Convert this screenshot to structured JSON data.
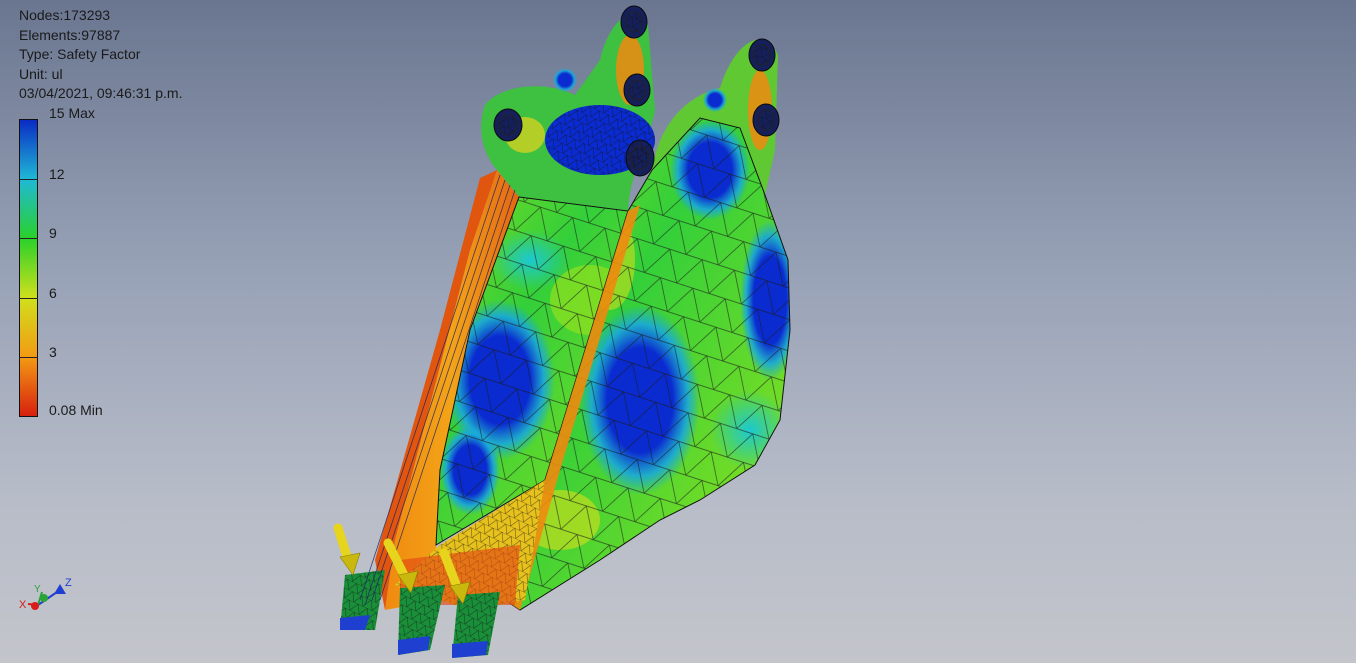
{
  "info": {
    "nodes": "Nodes:173293",
    "elements": "Elements:97887",
    "type": "Type: Safety Factor",
    "unit": "Unit: ul",
    "timestamp": "03/04/2021, 09:46:31 p.m."
  },
  "legend": {
    "max_label": "15 Max",
    "min_label": "0.08 Min",
    "ticks": [
      "12",
      "9",
      "6",
      "3"
    ],
    "colors": [
      "#0a2bc4",
      "#1fb9d6",
      "#2ad12a",
      "#cfe01c",
      "#f39b14",
      "#d8200e"
    ]
  },
  "axis_triad": {
    "x_label": "X",
    "y_label": "Y",
    "z_label": "Z",
    "x_color": "#d81b1b",
    "y_color": "#2aa33a",
    "z_color": "#1e3fd1"
  },
  "model": {
    "description_icon": "excavator-bucket-mesh",
    "load_arrow_color": "#e6d51c"
  }
}
